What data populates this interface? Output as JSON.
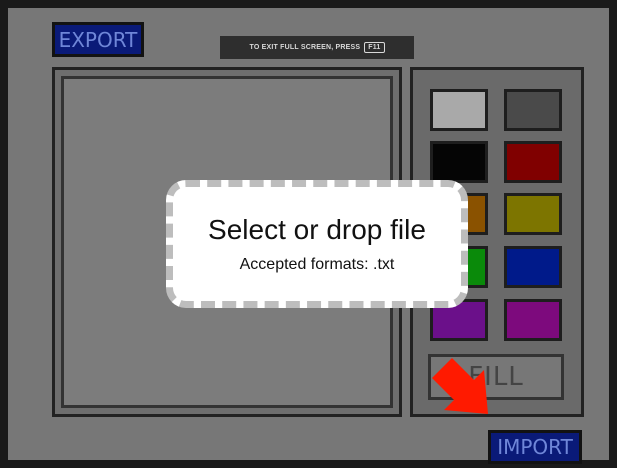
{
  "toolbar": {
    "export_label": "EXPORT",
    "import_label": "IMPORT"
  },
  "fullscreen_hint": {
    "text": "TO EXIT FULL SCREEN, PRESS",
    "key": "F11"
  },
  "palette": {
    "swatches": [
      {
        "name": "light-gray",
        "color": "#a9a9a9"
      },
      {
        "name": "dark-gray",
        "color": "#4a4a4a"
      },
      {
        "name": "black",
        "color": "#050505"
      },
      {
        "name": "red",
        "color": "#800000"
      },
      {
        "name": "orange",
        "color": "#8a5200"
      },
      {
        "name": "olive",
        "color": "#7d7500"
      },
      {
        "name": "green",
        "color": "#0a8a0a"
      },
      {
        "name": "blue",
        "color": "#001a8a"
      },
      {
        "name": "purple",
        "color": "#6b108a"
      },
      {
        "name": "magenta",
        "color": "#7d0a7d"
      }
    ],
    "fill_label": "FILL"
  },
  "drop_zone": {
    "title": "Select or drop file",
    "subtitle": "Accepted formats: .txt"
  },
  "pointer_icon": "red-arrow-icon",
  "accent_color": "#ff1a00"
}
